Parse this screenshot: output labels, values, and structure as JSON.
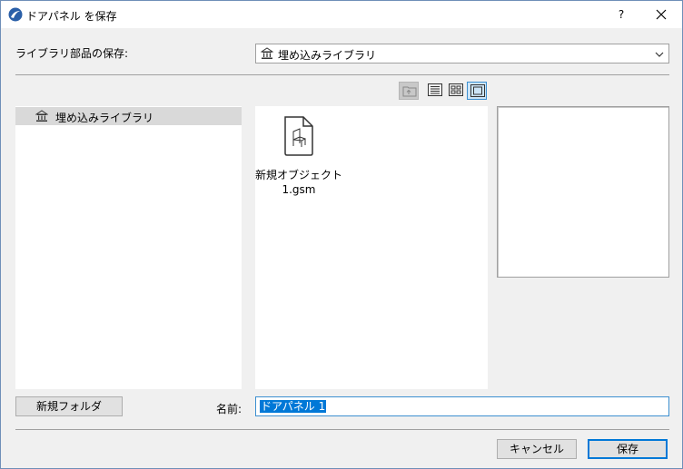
{
  "window": {
    "title": "ドアパネル を保存",
    "help_label": "?"
  },
  "library": {
    "label": "ライブラリ部品の保存:",
    "selected": "埋め込みライブラリ"
  },
  "toolbar": {
    "view_mode_selected": "preview"
  },
  "tree": {
    "items": [
      {
        "label": "埋め込みライブラリ",
        "selected": true
      }
    ]
  },
  "files": {
    "items": [
      {
        "name": "新規オブジェクト 1.gsm"
      }
    ]
  },
  "form": {
    "new_folder_label": "新規フォルダ",
    "name_label": "名前:",
    "name_value": "ドアパネル 1"
  },
  "actions": {
    "cancel_label": "キャンセル",
    "save_label": "保存"
  },
  "colors": {
    "accent": "#0078d7",
    "selection_bg": "#d9d9d9"
  }
}
